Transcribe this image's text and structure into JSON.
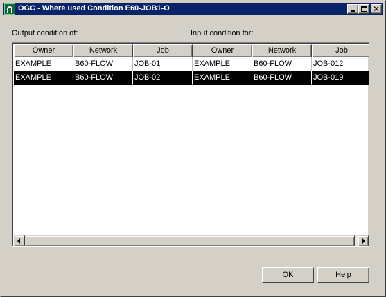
{
  "window": {
    "title": "OGC - Where used Condition E60-JOB1-O",
    "controls": {
      "minimize_icon": "minimize-icon",
      "maximize_icon": "maximize-icon",
      "close_icon": "close-icon",
      "close_glyph": "✕"
    }
  },
  "labels": {
    "output": "Output condition of:",
    "input": "Input condition for:"
  },
  "table": {
    "columns": [
      "Owner",
      "Network",
      "Job",
      "Owner",
      "Network",
      "Job"
    ],
    "rows": [
      {
        "cells": [
          "EXAMPLE",
          "B60-FLOW",
          "JOB-01",
          "EXAMPLE",
          "B60-FLOW",
          "JOB-012"
        ],
        "selected": false
      },
      {
        "cells": [
          "EXAMPLE",
          "B60-FLOW",
          "JOB-02",
          "EXAMPLE",
          "B60-FLOW",
          "JOB-019"
        ],
        "selected": true
      }
    ]
  },
  "buttons": {
    "ok": "OK",
    "help_prefix": "H",
    "help_rest": "elp"
  },
  "colors": {
    "titlebar": "#0a246a",
    "selection": "#000000",
    "face": "#d4d0c8"
  }
}
